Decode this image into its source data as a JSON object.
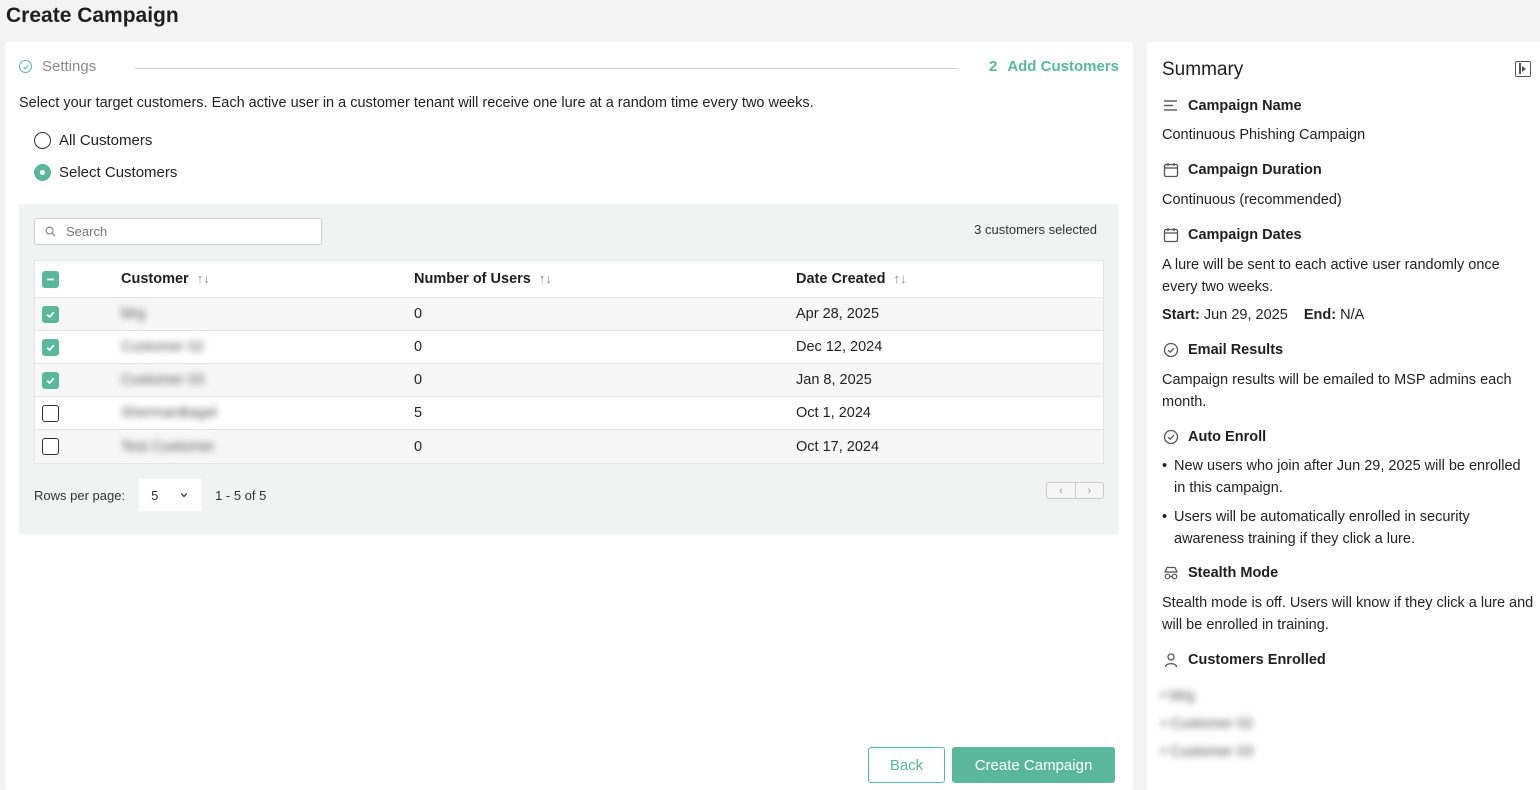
{
  "page": {
    "title": "Create Campaign"
  },
  "stepper": {
    "step1_label": "Settings",
    "step2_number": "2",
    "step2_label": "Add Customers"
  },
  "intro": "Select your target customers. Each active user in a customer tenant will receive one lure at a random time every two weeks.",
  "radios": [
    {
      "label": "All Customers",
      "selected": false
    },
    {
      "label": "Select Customers",
      "selected": true
    }
  ],
  "table": {
    "search_placeholder": "Search",
    "selected_count": "3 customers selected",
    "headers": {
      "customer": "Customer",
      "users": "Number of Users",
      "date": "Date Created"
    },
    "sort_icon": "↑↓",
    "rows": [
      {
        "customer": "blrg",
        "users": "0",
        "date": "Apr 28, 2025",
        "checked": true
      },
      {
        "customer": "Customer 02",
        "users": "0",
        "date": "Dec 12, 2024",
        "checked": true
      },
      {
        "customer": "Customer 03",
        "users": "0",
        "date": "Jan 8, 2025",
        "checked": true
      },
      {
        "customer": "ShermanBagel",
        "users": "5",
        "date": "Oct 1, 2024",
        "checked": false
      },
      {
        "customer": "Test Customer",
        "users": "0",
        "date": "Oct 17, 2024",
        "checked": false
      }
    ],
    "rows_per_page_label": "Rows per page:",
    "rows_per_page": "5",
    "range": "1 - 5 of 5",
    "prev_glyph": "‹",
    "next_glyph": "›"
  },
  "buttons": {
    "back": "Back",
    "create": "Create Campaign"
  },
  "summary": {
    "title": "Summary",
    "campaign_name_label": "Campaign Name",
    "campaign_name": "Continuous Phishing Campaign",
    "duration_label": "Campaign Duration",
    "duration": "Continuous (recommended)",
    "dates_label": "Campaign Dates",
    "dates_text": "A lure will be sent to each active user randomly once every two weeks.",
    "start_label": "Start:",
    "start_value": "Jun 29, 2025",
    "end_label": "End:",
    "end_value": "N/A",
    "email_label": "Email Results",
    "email_text": "Campaign results will be emailed to MSP admins each month.",
    "auto_label": "Auto Enroll",
    "auto_bullets": [
      "New users who join after Jun 29, 2025 will be enrolled in this campaign.",
      "Users will be automatically enrolled in security awareness training if they click a lure."
    ],
    "stealth_label": "Stealth Mode",
    "stealth_text": "Stealth mode is off. Users will know if they click a lure and will be enrolled in training.",
    "enrolled_label": "Customers Enrolled",
    "enrolled": [
      "• blrg",
      "• Customer 02",
      "• Customer 03"
    ]
  },
  "colors": {
    "accent": "#5ab79a",
    "panel_gray": "#f1f2f2",
    "page_bg": "#f3f3f3"
  },
  "icons": {
    "step_done": "check-circle-icon",
    "search": "search-icon",
    "chevron": "chevron-down-icon",
    "name": "text-lines-icon",
    "calendar": "calendar-icon",
    "check": "check-circle-icon",
    "stealth": "incognito-icon",
    "user": "user-icon",
    "panel_toggle": "panel-collapse-icon"
  }
}
